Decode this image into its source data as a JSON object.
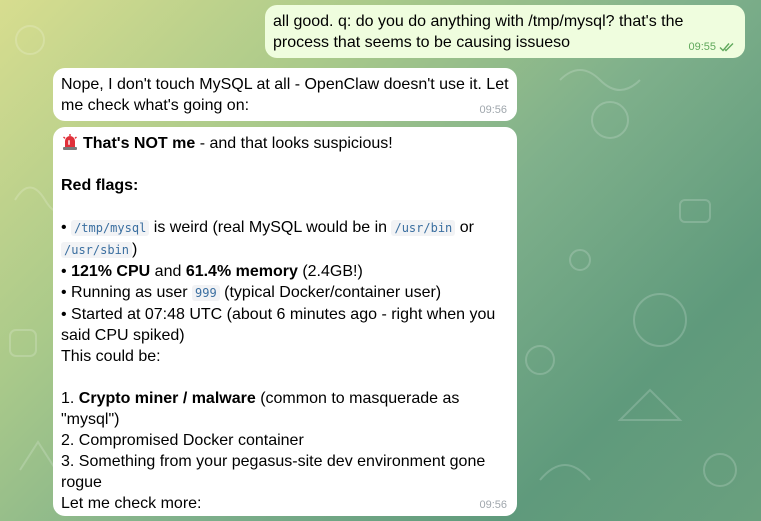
{
  "chat": {
    "messages": [
      {
        "direction": "out",
        "text": "all good. q: do you do anything with /tmp/mysql? that's the process that seems to be causing issueso",
        "time": "09:55",
        "status_icon": "double-check-icon"
      },
      {
        "direction": "in",
        "text": "Nope, I don't touch MySQL at all - OpenClaw doesn't use it. Let me check what's going on:",
        "time": "09:56"
      },
      {
        "direction": "in",
        "time": "09:56",
        "heading_icon": "siren-icon",
        "heading_bold": "That's NOT me",
        "heading_rest": " - and that looks suspicious!",
        "red_flags_title": "Red flags:",
        "flag1": {
          "bullet": "•",
          "code1": "/tmp/mysql",
          "text1": " is weird (real MySQL would be in ",
          "code2": "/usr/bin",
          "text2": " or",
          "code3": "/usr/sbin",
          "text3": ")"
        },
        "flag2": {
          "bullet": "•",
          "bold1": "121% CPU",
          "text1": " and ",
          "bold2": "61.4% memory",
          "text2": " (2.4GB!)"
        },
        "flag3": {
          "bullet": "•",
          "text1": " Running as user ",
          "code1": "999",
          "text2": " (typical Docker/container user)"
        },
        "flag4": "• Started at 07:48 UTC (about 6 minutes ago - right when you said CPU spiked)",
        "could_be": "This could be:",
        "item1": {
          "num": "1. ",
          "bold": "Crypto miner / malware",
          "text": " (common to masquerade as \"mysql\")"
        },
        "item2": "2. Compromised Docker container",
        "item3": "3. Something from your pegasus-site dev environment gone rogue",
        "closing": "Let me check more:"
      }
    ]
  },
  "colors": {
    "outgoing_bubble": "#effdde",
    "incoming_bubble": "#ffffff",
    "read_check": "#5fa85b",
    "code_text": "#3b6fa0"
  }
}
